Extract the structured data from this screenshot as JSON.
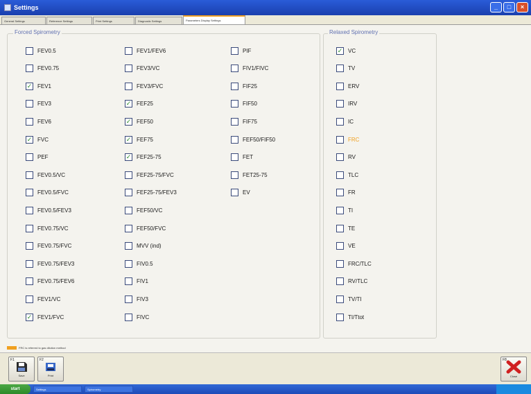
{
  "window": {
    "title": "Settings"
  },
  "tabs": [
    {
      "label": "General Settings",
      "active": false
    },
    {
      "label": "Reference Settings",
      "active": false
    },
    {
      "label": "Print Settings",
      "active": false
    },
    {
      "label": "Diagnostic Settings",
      "active": false
    },
    {
      "label": "Parameters Display Settings",
      "active": true
    }
  ],
  "forced": {
    "title": "Forced Spirometry",
    "columns": [
      [
        {
          "label": "FEV0.5",
          "checked": false
        },
        {
          "label": "FEV0.75",
          "checked": false
        },
        {
          "label": "FEV1",
          "checked": true
        },
        {
          "label": "FEV3",
          "checked": false
        },
        {
          "label": "FEV6",
          "checked": false
        },
        {
          "label": "FVC",
          "checked": true
        },
        {
          "label": "PEF",
          "checked": false
        },
        {
          "label": "FEV0.5/VC",
          "checked": false
        },
        {
          "label": "FEV0.5/FVC",
          "checked": false
        },
        {
          "label": "FEV0.5/FEV3",
          "checked": false
        },
        {
          "label": "FEV0.75/VC",
          "checked": false
        },
        {
          "label": "FEV0.75/FVC",
          "checked": false
        },
        {
          "label": "FEV0.75/FEV3",
          "checked": false
        },
        {
          "label": "FEV0.75/FEV6",
          "checked": false
        },
        {
          "label": "FEV1/VC",
          "checked": false
        },
        {
          "label": "FEV1/FVC",
          "checked": true
        }
      ],
      [
        {
          "label": "FEV1/FEV6",
          "checked": false
        },
        {
          "label": "FEV3/VC",
          "checked": false
        },
        {
          "label": "FEV3/FVC",
          "checked": false
        },
        {
          "label": "FEF25",
          "checked": true
        },
        {
          "label": "FEF50",
          "checked": true
        },
        {
          "label": "FEF75",
          "checked": true
        },
        {
          "label": "FEF25-75",
          "checked": true
        },
        {
          "label": "FEF25-75/FVC",
          "checked": false
        },
        {
          "label": "FEF25-75/FEV3",
          "checked": false
        },
        {
          "label": "FEF50/VC",
          "checked": false
        },
        {
          "label": "FEF50/FVC",
          "checked": false
        },
        {
          "label": "MVV (ind)",
          "checked": false
        },
        {
          "label": "FIV0.5",
          "checked": false
        },
        {
          "label": "FIV1",
          "checked": false
        },
        {
          "label": "FIV3",
          "checked": false
        },
        {
          "label": "FIVC",
          "checked": false
        }
      ],
      [
        {
          "label": "PIF",
          "checked": false
        },
        {
          "label": "FIV1/FIVC",
          "checked": false
        },
        {
          "label": "FIF25",
          "checked": false
        },
        {
          "label": "FIF50",
          "checked": false
        },
        {
          "label": "FIF75",
          "checked": false
        },
        {
          "label": "FEF50/FIF50",
          "checked": false
        },
        {
          "label": "FET",
          "checked": false
        },
        {
          "label": "FET25-75",
          "checked": false
        },
        {
          "label": "EV",
          "checked": false
        }
      ]
    ]
  },
  "relaxed": {
    "title": "Relaxed Spirometry",
    "items": [
      {
        "label": "VC",
        "checked": true,
        "highlight": false
      },
      {
        "label": "TV",
        "checked": false,
        "highlight": false
      },
      {
        "label": "ERV",
        "checked": false,
        "highlight": false
      },
      {
        "label": "IRV",
        "checked": false,
        "highlight": false
      },
      {
        "label": "IC",
        "checked": false,
        "highlight": false
      },
      {
        "label": "FRC",
        "checked": false,
        "highlight": true
      },
      {
        "label": "RV",
        "checked": false,
        "highlight": false
      },
      {
        "label": "TLC",
        "checked": false,
        "highlight": false
      },
      {
        "label": "FR",
        "checked": false,
        "highlight": false
      },
      {
        "label": "TI",
        "checked": false,
        "highlight": false
      },
      {
        "label": "TE",
        "checked": false,
        "highlight": false
      },
      {
        "label": "VE",
        "checked": false,
        "highlight": false
      },
      {
        "label": "FRC/TLC",
        "checked": false,
        "highlight": false
      },
      {
        "label": "RV/TLC",
        "checked": false,
        "highlight": false
      },
      {
        "label": "TV/TI",
        "checked": false,
        "highlight": false
      },
      {
        "label": "TI/Ttot",
        "checked": false,
        "highlight": false
      }
    ]
  },
  "status": {
    "text": "FRC is referred to gas dilution method",
    "accent": "#f0a020"
  },
  "toolbar": {
    "save": {
      "fkey": "F1",
      "caption": "Save"
    },
    "print": {
      "fkey": "F2",
      "caption": "Print"
    },
    "close": {
      "fkey": "F8",
      "caption": "Close"
    }
  },
  "taskbar": {
    "start": "start",
    "items": [
      "Settings",
      "Spirometry"
    ]
  }
}
